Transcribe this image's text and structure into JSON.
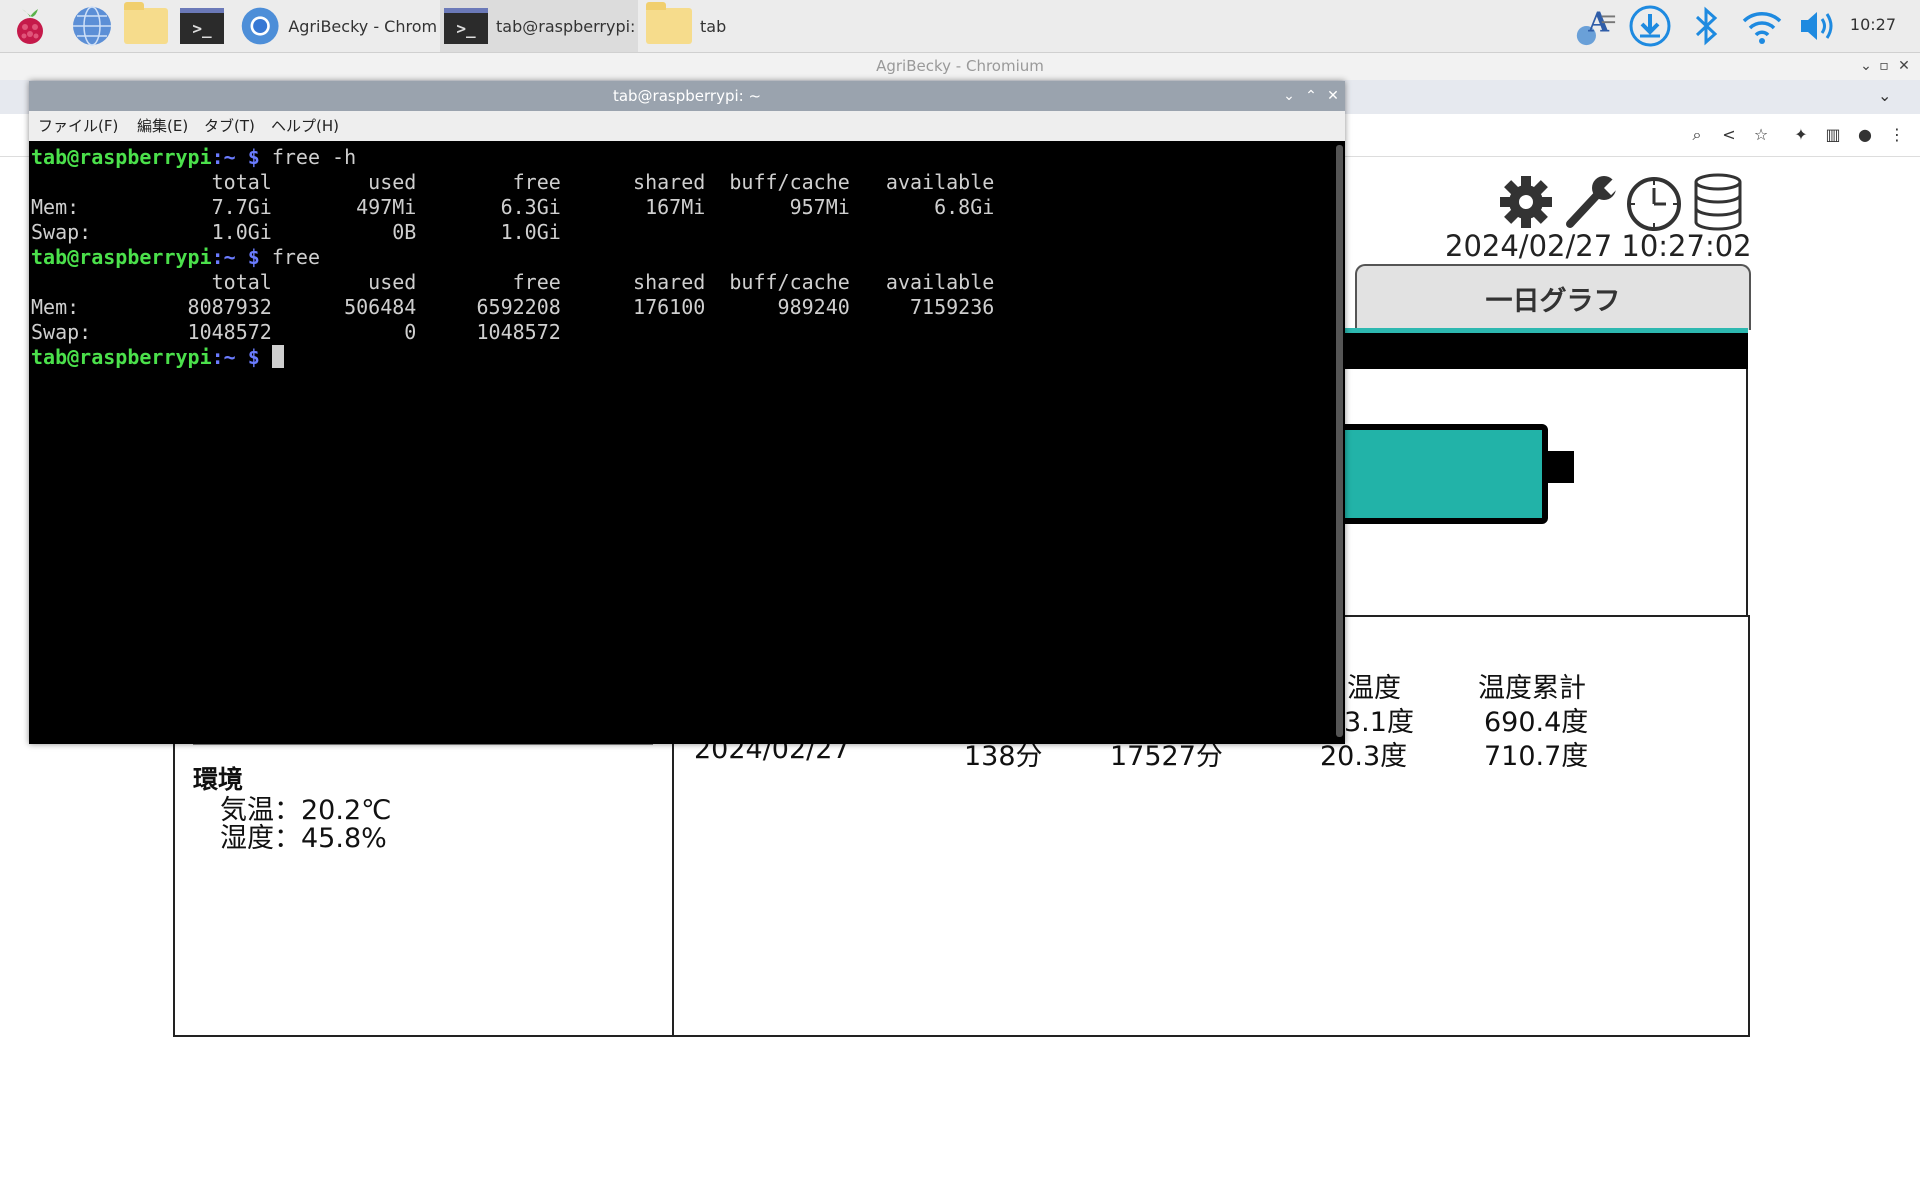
{
  "taskbar": {
    "tasks": [
      {
        "label": "AgriBecky - Chromi..."
      },
      {
        "label": "tab@raspberrypi: ~"
      },
      {
        "label": "tab"
      }
    ],
    "clock": "10:27"
  },
  "browser": {
    "window_title": "AgriBecky - Chromium",
    "page": {
      "datetime": "2024/02/27 10:27:02",
      "tab_graph_label": "一日グラフ",
      "table": {
        "headers": [
          "内温度",
          "温度累計"
        ],
        "rows": [
          [
            "",
            "",
            "",
            "3.1度",
            "690.4度"
          ],
          [
            "2024/02/27",
            "138分",
            "17527分",
            "20.3度",
            "710.7度"
          ]
        ]
      },
      "env": {
        "title": "環境",
        "temp": "気温：20.2℃",
        "humidity": "湿度：45.8%"
      }
    }
  },
  "terminal": {
    "title": "tab@raspberrypi: ~",
    "menu": [
      "ファイル(F)",
      "編集(E)",
      "タブ(T)",
      "ヘルプ(H)"
    ],
    "prompt_user": "tab@raspberrypi",
    "prompt_dir": ":~ $",
    "lines": [
      {
        "type": "cmd",
        "cmd": " free -h"
      },
      {
        "type": "out",
        "text": "               total        used        free      shared  buff/cache   available"
      },
      {
        "type": "out",
        "text": "Mem:           7.7Gi       497Mi       6.3Gi       167Mi       957Mi       6.8Gi"
      },
      {
        "type": "out",
        "text": "Swap:          1.0Gi          0B       1.0Gi"
      },
      {
        "type": "cmd",
        "cmd": " free"
      },
      {
        "type": "out",
        "text": "               total        used        free      shared  buff/cache   available"
      },
      {
        "type": "out",
        "text": "Mem:         8087932      506484     6592208      176100      989240     7159236"
      },
      {
        "type": "out",
        "text": "Swap:        1048572           0     1048572"
      },
      {
        "type": "cmd",
        "cmd": " "
      }
    ]
  }
}
